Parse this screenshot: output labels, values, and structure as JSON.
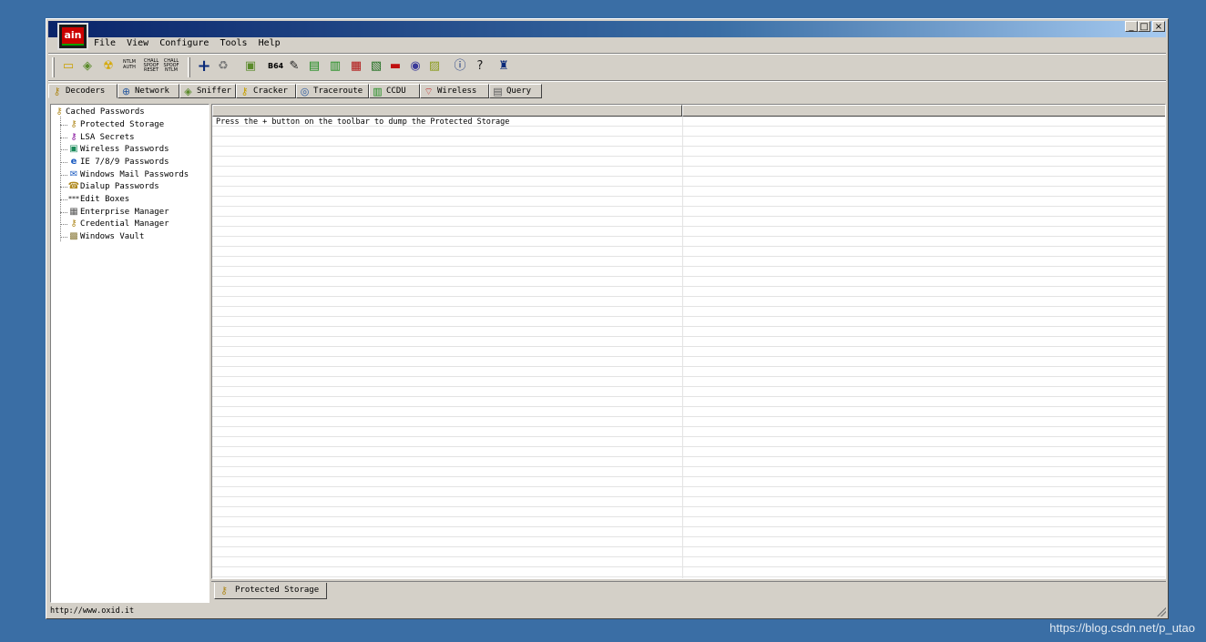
{
  "window": {
    "title": "",
    "logo_text": "ain",
    "controls": {
      "minimize": "_",
      "maximize": "□",
      "close": "×"
    }
  },
  "menu": [
    "File",
    "View",
    "Configure",
    "Tools",
    "Help"
  ],
  "toolbar_icons": [
    "open-icon",
    "sniffer-icon",
    "radioactive-icon",
    "ntlm-auth-icon",
    "chall-spoof-reset-icon",
    "chall-spoof-ntlm-icon",
    "add-icon",
    "hash-icon",
    "base64-icon",
    "proxy-icon",
    "dsa-icon",
    "vpn-icon",
    "pc-icon",
    "access-icon",
    "box-icon",
    "speaker-icon",
    "recycle-icon",
    "about-icon",
    "help-icon",
    "tower-icon"
  ],
  "toolbar_labels": {
    "ntlm": "NTLM AUTH",
    "chall1": "CHALL SPOOF RESET",
    "chall2": "CHALL SPOOF NTLM",
    "b64": "B64"
  },
  "tabs": [
    "Decoders",
    "Network",
    "Sniffer",
    "Cracker",
    "Traceroute",
    "CCDU",
    "Wireless",
    "Query"
  ],
  "tree": {
    "root": "Cached Passwords",
    "items": [
      "Protected Storage",
      "LSA Secrets",
      "Wireless Passwords",
      "IE 7/8/9 Passwords",
      "Windows Mail Passwords",
      "Dialup Passwords",
      "Edit Boxes",
      "Enterprise Manager",
      "Credential Manager",
      "Windows Vault"
    ]
  },
  "list": {
    "columns": [
      "",
      ""
    ],
    "message": "Press the + button on the toolbar to dump the Protected Storage"
  },
  "subtab": "Protected Storage",
  "status": "http://www.oxid.it",
  "watermark": "https://blog.csdn.net/p_utao",
  "colors": {
    "desktop": "#3a6ea5",
    "face": "#d4d0c8",
    "title_start": "#0a246a"
  }
}
